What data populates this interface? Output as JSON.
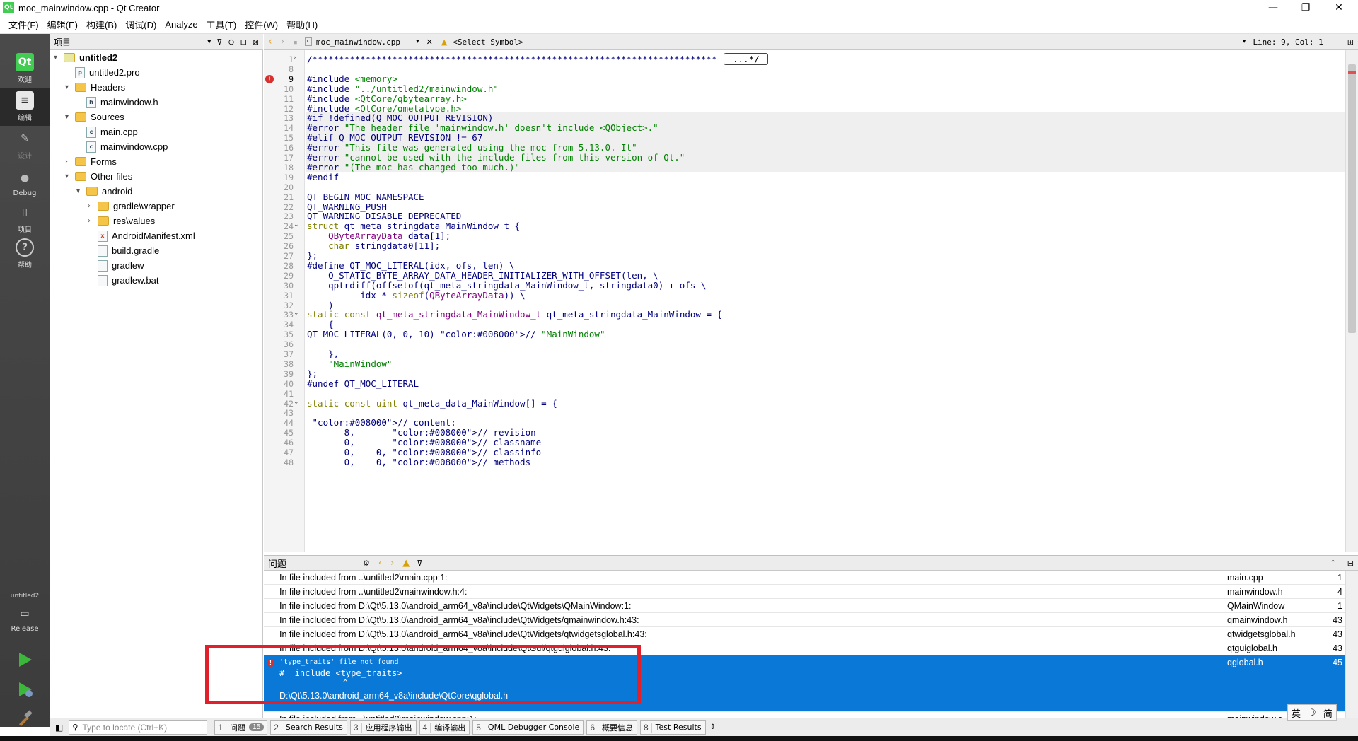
{
  "window": {
    "title": "moc_mainwindow.cpp - Qt Creator",
    "app_icon": "Qt",
    "minimize": "—",
    "restore": "❐",
    "close": "✕"
  },
  "menu": [
    "文件(F)",
    "编辑(E)",
    "构建(B)",
    "调试(D)",
    "Analyze",
    "工具(T)",
    "控件(W)",
    "帮助(H)"
  ],
  "modes": {
    "welcome": "欢迎",
    "edit": "编辑",
    "design": "设计",
    "debug": "Debug",
    "projects": "项目",
    "help": "帮助",
    "kit_name": "untitled2",
    "build_config": "Release"
  },
  "project_panel": {
    "title": "项目",
    "tree": [
      {
        "label": "untitled2",
        "indent": 0,
        "arrow": "▾",
        "icon": "project"
      },
      {
        "label": "untitled2.pro",
        "indent": 1,
        "arrow": "",
        "icon": "pro"
      },
      {
        "label": "Headers",
        "indent": 1,
        "arrow": "▾",
        "icon": "h-folder"
      },
      {
        "label": "mainwindow.h",
        "indent": 2,
        "arrow": "",
        "icon": "h"
      },
      {
        "label": "Sources",
        "indent": 1,
        "arrow": "▾",
        "icon": "cpp-folder"
      },
      {
        "label": "main.cpp",
        "indent": 2,
        "arrow": "",
        "icon": "cpp"
      },
      {
        "label": "mainwindow.cpp",
        "indent": 2,
        "arrow": "",
        "icon": "cpp"
      },
      {
        "label": "Forms",
        "indent": 1,
        "arrow": "›",
        "icon": "folder"
      },
      {
        "label": "Other files",
        "indent": 1,
        "arrow": "▾",
        "icon": "folder"
      },
      {
        "label": "android",
        "indent": 2,
        "arrow": "▾",
        "icon": "folder"
      },
      {
        "label": "gradle\\wrapper",
        "indent": 3,
        "arrow": "›",
        "icon": "folder"
      },
      {
        "label": "res\\values",
        "indent": 3,
        "arrow": "›",
        "icon": "folder"
      },
      {
        "label": "AndroidManifest.xml",
        "indent": 3,
        "arrow": "",
        "icon": "xml"
      },
      {
        "label": "build.gradle",
        "indent": 3,
        "arrow": "",
        "icon": "file"
      },
      {
        "label": "gradlew",
        "indent": 3,
        "arrow": "",
        "icon": "file"
      },
      {
        "label": "gradlew.bat",
        "indent": 3,
        "arrow": "",
        "icon": "file"
      }
    ]
  },
  "editor": {
    "file_tab": "moc_mainwindow.cpp",
    "symbol": "<Select Symbol>",
    "position": "Line: 9, Col: 1",
    "lines": [
      {
        "n": "1",
        "text": "/****************************************************************************",
        "fold": "›",
        "extra": " ...*/ "
      },
      {
        "n": "8",
        "text": ""
      },
      {
        "n": "9",
        "text": "#include <memory>",
        "error": true
      },
      {
        "n": "10",
        "text": "#include \"../untitled2/mainwindow.h\""
      },
      {
        "n": "11",
        "text": "#include <QtCore/qbytearray.h>"
      },
      {
        "n": "12",
        "text": "#include <QtCore/qmetatype.h>"
      },
      {
        "n": "13",
        "text": "#if !defined(Q_MOC_OUTPUT_REVISION)",
        "dim": true
      },
      {
        "n": "14",
        "text": "#error \"The header file 'mainwindow.h' doesn't include <QObject>.\"",
        "dim": true
      },
      {
        "n": "15",
        "text": "#elif Q_MOC_OUTPUT_REVISION != 67",
        "dim": true
      },
      {
        "n": "16",
        "text": "#error \"This file was generated using the moc from 5.13.0. It\"",
        "dim": true
      },
      {
        "n": "17",
        "text": "#error \"cannot be used with the include files from this version of Qt.\"",
        "dim": true
      },
      {
        "n": "18",
        "text": "#error \"(The moc has changed too much.)\"",
        "dim": true
      },
      {
        "n": "19",
        "text": "#endif"
      },
      {
        "n": "20",
        "text": ""
      },
      {
        "n": "21",
        "text": "QT_BEGIN_MOC_NAMESPACE"
      },
      {
        "n": "22",
        "text": "QT_WARNING_PUSH"
      },
      {
        "n": "23",
        "text": "QT_WARNING_DISABLE_DEPRECATED"
      },
      {
        "n": "24",
        "text": "struct qt_meta_stringdata_MainWindow_t {",
        "fold": "⌄"
      },
      {
        "n": "25",
        "text": "    QByteArrayData data[1];"
      },
      {
        "n": "26",
        "text": "    char stringdata0[11];"
      },
      {
        "n": "27",
        "text": "};"
      },
      {
        "n": "28",
        "text": "#define QT_MOC_LITERAL(idx, ofs, len) \\"
      },
      {
        "n": "29",
        "text": "    Q_STATIC_BYTE_ARRAY_DATA_HEADER_INITIALIZER_WITH_OFFSET(len, \\"
      },
      {
        "n": "30",
        "text": "    qptrdiff(offsetof(qt_meta_stringdata_MainWindow_t, stringdata0) + ofs \\"
      },
      {
        "n": "31",
        "text": "        - idx * sizeof(QByteArrayData)) \\"
      },
      {
        "n": "32",
        "text": "    )"
      },
      {
        "n": "33",
        "text": "static const qt_meta_stringdata_MainWindow_t qt_meta_stringdata_MainWindow = {",
        "fold": "⌄"
      },
      {
        "n": "34",
        "text": "    {"
      },
      {
        "n": "35",
        "text": "QT_MOC_LITERAL(0, 0, 10) // \"MainWindow\""
      },
      {
        "n": "36",
        "text": ""
      },
      {
        "n": "37",
        "text": "    },"
      },
      {
        "n": "38",
        "text": "    \"MainWindow\""
      },
      {
        "n": "39",
        "text": "};"
      },
      {
        "n": "40",
        "text": "#undef QT_MOC_LITERAL"
      },
      {
        "n": "41",
        "text": ""
      },
      {
        "n": "42",
        "text": "static const uint qt_meta_data_MainWindow[] = {",
        "fold": "⌄"
      },
      {
        "n": "43",
        "text": ""
      },
      {
        "n": "44",
        "text": " // content:"
      },
      {
        "n": "45",
        "text": "       8,       // revision"
      },
      {
        "n": "46",
        "text": "       0,       // classname"
      },
      {
        "n": "47",
        "text": "       0,    0, // classinfo"
      },
      {
        "n": "48",
        "text": "       0,    0, // methods"
      }
    ]
  },
  "issues": {
    "title": "问题",
    "rows": [
      {
        "desc": "In file included from ..\\untitled2\\main.cpp:1:",
        "file": "main.cpp",
        "line": "1"
      },
      {
        "desc": "In file included from ..\\untitled2\\mainwindow.h:4:",
        "file": "mainwindow.h",
        "line": "4"
      },
      {
        "desc": "In file included from D:\\Qt\\5.13.0\\android_arm64_v8a\\include\\QtWidgets\\QMainWindow:1:",
        "file": "QMainWindow",
        "line": "1"
      },
      {
        "desc": "In file included from D:\\Qt\\5.13.0\\android_arm64_v8a\\include\\QtWidgets/qmainwindow.h:43:",
        "file": "qmainwindow.h",
        "line": "43"
      },
      {
        "desc": "In file included from D:\\Qt\\5.13.0\\android_arm64_v8a\\include\\QtWidgets/qtwidgetsglobal.h:43:",
        "file": "qtwidgetsglobal.h",
        "line": "43"
      },
      {
        "desc": "In file included from D:\\Qt\\5.13.0\\android_arm64_v8a\\include\\QtGui/qtguiglobal.h:43:",
        "file": "qtguiglobal.h",
        "line": "43"
      }
    ],
    "selected": {
      "message": "'type_traits' file not found",
      "code": "#  include <type_traits>",
      "caret": "^",
      "path": "D:\\Qt\\5.13.0\\android_arm64_v8a\\include\\QtCore\\qglobal.h",
      "file": "qglobal.h",
      "line": "45"
    },
    "last_row": {
      "desc": "In file included from ..\\untitled2\\mainwindow.cpp:1:",
      "file": "mainwindow.c",
      "line": ""
    }
  },
  "bottom": {
    "locator_placeholder": "Type to locate (Ctrl+K)",
    "panes": [
      {
        "num": "1",
        "label": "问题",
        "badge": "15"
      },
      {
        "num": "2",
        "label": "Search Results"
      },
      {
        "num": "3",
        "label": "应用程序输出"
      },
      {
        "num": "4",
        "label": "编译输出"
      },
      {
        "num": "5",
        "label": "QML Debugger Console"
      },
      {
        "num": "6",
        "label": "概要信息"
      },
      {
        "num": "8",
        "label": "Test Results"
      }
    ],
    "ime": [
      "英",
      "☽",
      "简"
    ]
  },
  "colors": {
    "accent_selection": "#0a78d7",
    "annotation_box": "#e0202a",
    "code_preprocessor": "#000080",
    "code_string": "#008000",
    "code_keyword": "#808000",
    "code_type": "#800080"
  }
}
